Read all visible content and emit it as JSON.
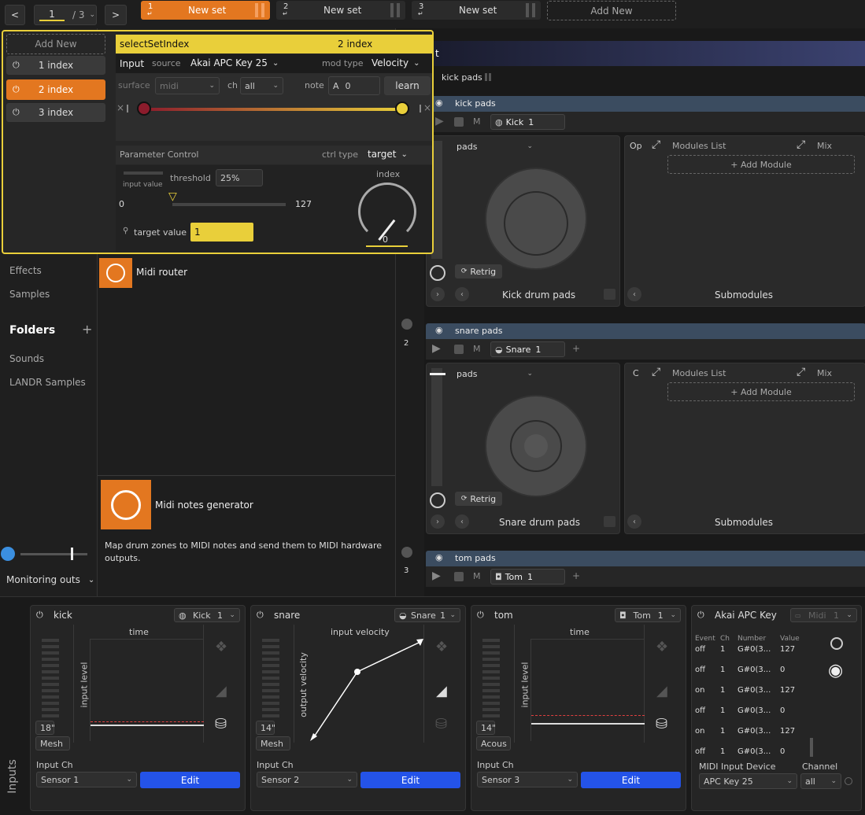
{
  "topbar": {
    "prev": "<",
    "next": ">",
    "page_current": "1",
    "page_total": "/ 3",
    "sets": [
      {
        "num": "1",
        "label": "New set"
      },
      {
        "num": "2",
        "label": "New set"
      },
      {
        "num": "3",
        "label": "New set"
      }
    ],
    "add_new": "Add New"
  },
  "popup": {
    "add_new": "Add New",
    "indexes": [
      "1 index",
      "2 index",
      "3 index"
    ],
    "header_title": "selectSetIndex",
    "header_value": "2 index",
    "input_label": "Input",
    "source_label": "source",
    "source_value": "Akai APC Key 25",
    "modtype_label": "mod type",
    "modtype_value": "Velocity",
    "surface_label": "surface",
    "surface_value": "midi",
    "ch_label": "ch",
    "ch_value": "all",
    "note_label": "note",
    "note_letter": "A",
    "note_value": "0",
    "learn": "learn",
    "param_title": "Parameter Control",
    "ctrltype_label": "ctrl type",
    "ctrltype_value": "target",
    "input_value_label": "input value",
    "threshold_label": "threshold",
    "threshold_value": "25%",
    "range_min": "0",
    "range_max": "127",
    "index_label": "index",
    "index_value": "0",
    "target_label": "target value",
    "target_value": "1"
  },
  "sidebar": {
    "effects": "Effects",
    "samples": "Samples",
    "folders": "Folders",
    "plus": "+",
    "sounds": "Sounds",
    "landr": "LANDR Samples",
    "monitoring": "Monitoring outs"
  },
  "browser": {
    "midi_router": "Midi router",
    "midi_notes": "Midi notes generator",
    "description": "Map drum zones to MIDI notes and send them to MIDI hardware outputs."
  },
  "rack": {
    "partial_title": "t",
    "breadcrumb": "kick pads",
    "tracks": [
      {
        "num": "",
        "title": "kick pads",
        "instrument": "Kick",
        "inst_num": "1",
        "pads": "pads",
        "op": "Op",
        "modules": "Modules List",
        "mix": "Mix",
        "add_module": "+ Add Module",
        "retrig": "Retrig",
        "pads_title": "Kick drum pads",
        "submodules": "Submodules"
      },
      {
        "num": "2",
        "title": "snare pads",
        "instrument": "Snare",
        "inst_num": "1",
        "pads": "pads",
        "op": "C",
        "modules": "Modules List",
        "mix": "Mix",
        "add_module": "+ Add Module",
        "retrig": "Retrig",
        "pads_title": "Snare drum pads",
        "submodules": "Submodules"
      },
      {
        "num": "3",
        "title": "tom pads",
        "instrument": "Tom",
        "inst_num": "1"
      }
    ],
    "m": "M",
    "plus": "+"
  },
  "inputs": {
    "side_label": "Inputs",
    "channels": [
      {
        "name": "kick",
        "instrument": "Kick",
        "num": "1",
        "graph_title": "time",
        "y_label": "input level",
        "size": "18\"",
        "type": "Mesh",
        "input_ch_label": "Input Ch",
        "sensor": "Sensor 1",
        "edit": "Edit"
      },
      {
        "name": "snare",
        "instrument": "Snare",
        "num": "1",
        "graph_title": "input velocity",
        "y_label": "output velocity",
        "size": "14\"",
        "type": "Mesh",
        "input_ch_label": "Input Ch",
        "sensor": "Sensor 2",
        "edit": "Edit"
      },
      {
        "name": "tom",
        "instrument": "Tom",
        "num": "1",
        "graph_title": "time",
        "y_label": "input level",
        "size": "14\"",
        "type": "Acous",
        "input_ch_label": "Input Ch",
        "sensor": "Sensor 3",
        "edit": "Edit"
      }
    ],
    "midi": {
      "name": "Akai APC Key",
      "type": "Midi",
      "num": "1",
      "headers": [
        "Event",
        "Ch",
        "Number",
        "Value"
      ],
      "rows": [
        [
          "off",
          "1",
          "G#0(3...",
          "127"
        ],
        [
          "off",
          "1",
          "G#0(3...",
          "0"
        ],
        [
          "on",
          "1",
          "G#0(3...",
          "127"
        ],
        [
          "off",
          "1",
          "G#0(3...",
          "0"
        ],
        [
          "on",
          "1",
          "G#0(3...",
          "127"
        ],
        [
          "off",
          "1",
          "G#0(3...",
          "0"
        ]
      ],
      "device_label": "MIDI Input Device",
      "device": "APC Key 25",
      "channel_label": "Channel",
      "channel": "all"
    }
  },
  "colors": {
    "accent": "#e37720",
    "yellow": "#e9cf3a",
    "blue": "#2453e8",
    "knob_red": "#8c1c2c"
  }
}
